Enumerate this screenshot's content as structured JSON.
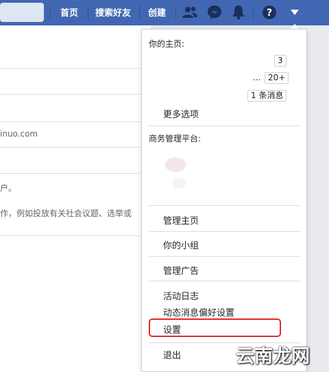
{
  "topbar": {
    "nav": [
      "首页",
      "搜索好友",
      "创建"
    ],
    "icons": [
      "friends-icon",
      "messenger-icon",
      "notifications-icon",
      "help-icon",
      "menu-caret-icon"
    ],
    "color": "#4267b2"
  },
  "background_page": {
    "email_fragment": "inuo.com",
    "line_a": "户。",
    "line_b": "作，例如投放有关社会议题、选举或"
  },
  "dropdown": {
    "section_pages": "你的主页:",
    "badges": [
      "3",
      "20+",
      "1 条消息"
    ],
    "ellipsis": "...",
    "more_options": "更多选项",
    "section_business": "商务管理平台:",
    "manage_pages": "管理主页",
    "your_groups": "你的小组",
    "manage_ads": "管理广告",
    "activity_log": "活动日志",
    "news_feed_prefs": "动态消息偏好设置",
    "settings": "设置",
    "logout": "退出"
  },
  "watermark": {
    "text": "云南龙网",
    "highlight_color": "#e02a2a"
  }
}
